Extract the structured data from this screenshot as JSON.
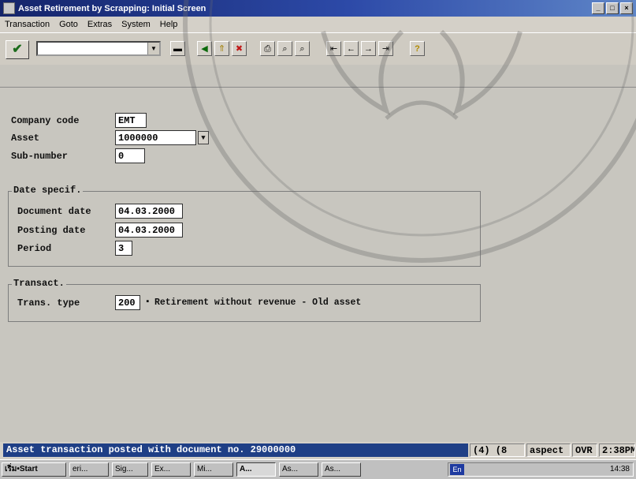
{
  "window": {
    "title": "Asset Retirement by Scrapping: Initial Screen",
    "controls": [
      "_",
      "□",
      "×"
    ]
  },
  "menu": {
    "items": [
      "Transaction",
      "Goto",
      "Extras",
      "System",
      "Help"
    ]
  },
  "toolbar": {
    "enter_icon": "✔",
    "command_field_value": "",
    "buttons": [
      {
        "icon": "save-icon",
        "glyph": "▬"
      },
      {
        "icon": "back-icon",
        "glyph": "◀"
      },
      {
        "icon": "exit-icon",
        "glyph": "⇑"
      },
      {
        "icon": "cancel-icon",
        "glyph": "✖"
      },
      {
        "icon": "print-icon",
        "glyph": "⎙"
      },
      {
        "icon": "find-icon",
        "glyph": "⌕"
      },
      {
        "icon": "find-next-icon",
        "glyph": "⌕"
      },
      {
        "icon": "first-page-icon",
        "glyph": "⇤"
      },
      {
        "icon": "prev-page-icon",
        "glyph": "←"
      },
      {
        "icon": "next-page-icon",
        "glyph": "→"
      },
      {
        "icon": "last-page-icon",
        "glyph": "⇥"
      },
      {
        "icon": "help-icon",
        "glyph": "?"
      }
    ]
  },
  "form": {
    "company_code": {
      "label": "Company code",
      "value": "EMT"
    },
    "asset": {
      "label": "Asset",
      "value": "1000000"
    },
    "sub_number": {
      "label": "Sub-number",
      "value": "0"
    },
    "date_group": {
      "title": "Date specif.",
      "document_date": {
        "label": "Document date",
        "value": "04.03.2000"
      },
      "posting_date": {
        "label": "Posting date",
        "value": "04.03.2000"
      },
      "period": {
        "label": "Period",
        "value": "3"
      }
    },
    "transact_group": {
      "title": "Transact.",
      "trans_type": {
        "label": "Trans. type",
        "value": "200",
        "description": "Retirement without revenue - Old asset"
      }
    }
  },
  "status": {
    "message": "Asset transaction posted with document no. 29000000",
    "session": "(4) (8",
    "server": "aspect",
    "mode": "OVR",
    "time": "2:38PM"
  },
  "taskbar": {
    "start_label": "เริ่ม•Start",
    "tasks": [
      "eri...",
      "Sig...",
      "Ex...",
      "Mi...",
      "A...",
      "As...",
      "As..."
    ],
    "lang": "En",
    "clock": "14:38"
  },
  "colors": {
    "title_bar": "#14246a",
    "status_msg_bg": "#1f3f86",
    "workarea_bg": "#c8c6bf"
  }
}
